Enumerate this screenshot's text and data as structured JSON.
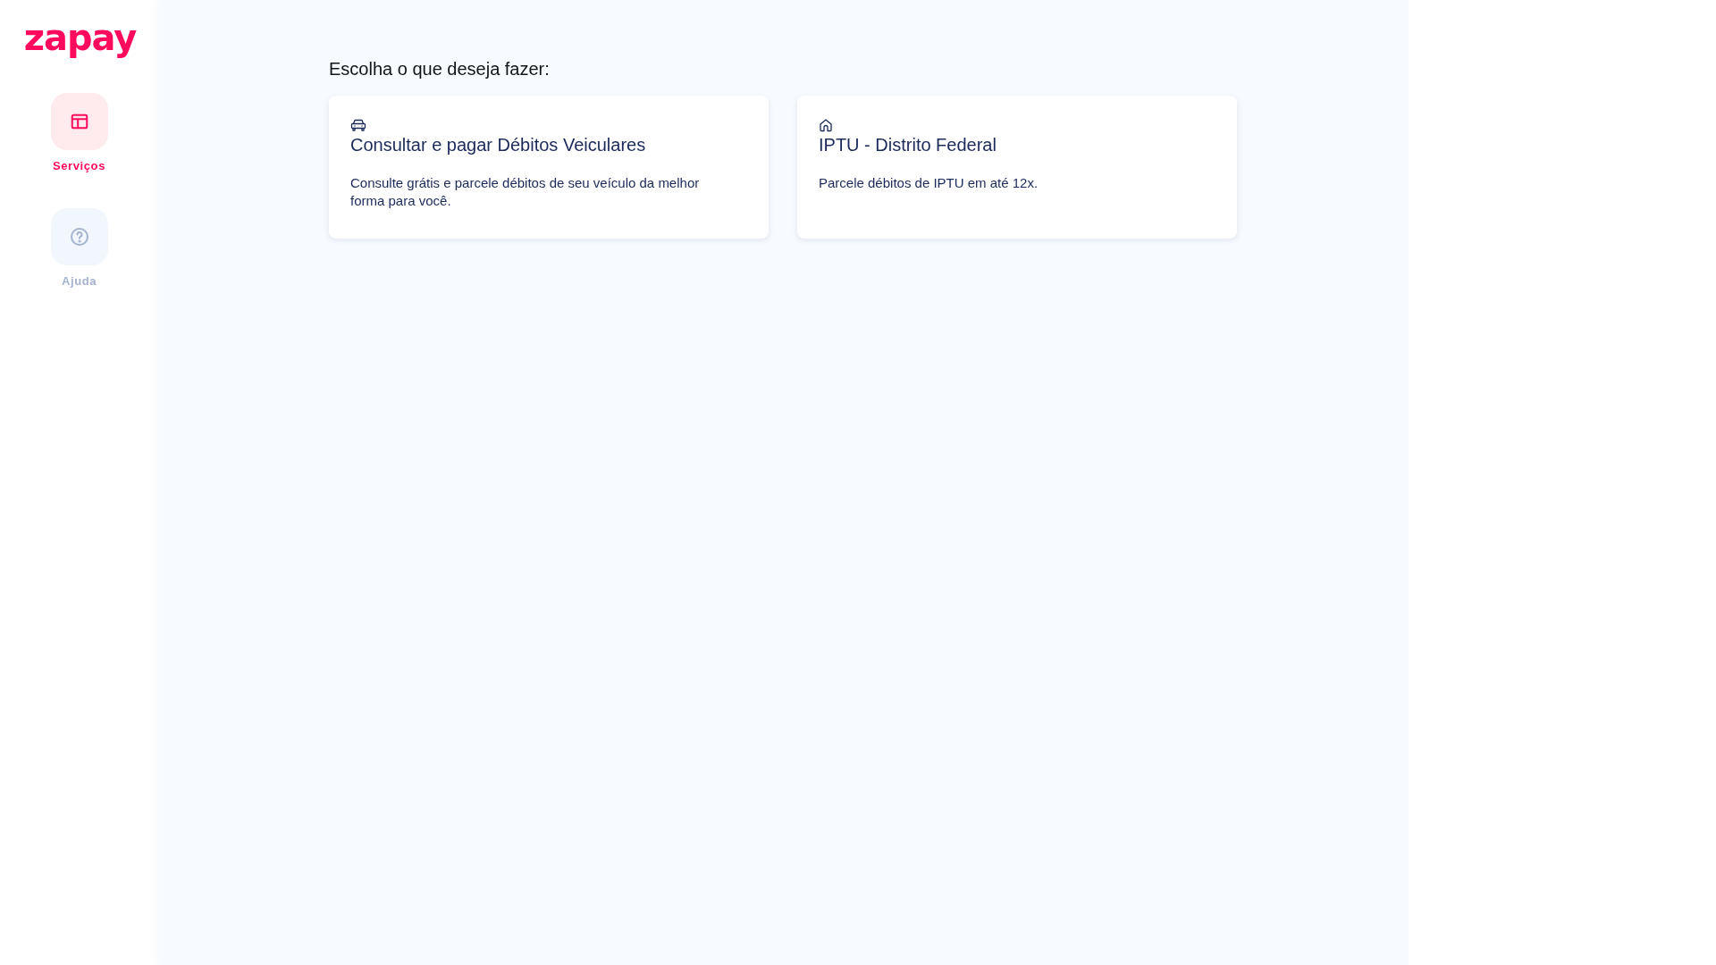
{
  "logo": {
    "text": "zapay"
  },
  "sidebar": {
    "items": [
      {
        "label": "Serviços",
        "kind": "layout",
        "selected": true
      },
      {
        "label": "Ajuda",
        "kind": "help",
        "selected": false
      }
    ]
  },
  "main": {
    "heading": "Escolha o que deseja fazer:",
    "cards": [
      {
        "kind": "car",
        "title": "Consultar e pagar Débitos Veiculares",
        "description": "Consulte grátis e parcele débitos de seu veículo da melhor forma para você."
      },
      {
        "kind": "house",
        "title": "IPTU - Distrito Federal",
        "description": "Parcele débitos de IPTU em até 12x."
      }
    ]
  }
}
